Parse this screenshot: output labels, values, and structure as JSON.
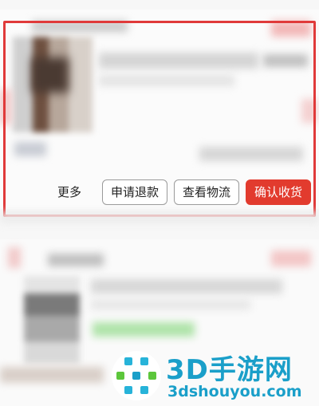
{
  "order_card": {
    "more_label": "更多",
    "refund_button": "申请退款",
    "logistics_button": "查看物流",
    "confirm_button": "确认收货"
  },
  "colors": {
    "highlight": "#e03a3a",
    "confirm_button": "#e23b2e",
    "watermark": "#1a9fc9"
  },
  "watermark": {
    "title": "3D手游网",
    "url": "3dshouyou.com"
  }
}
